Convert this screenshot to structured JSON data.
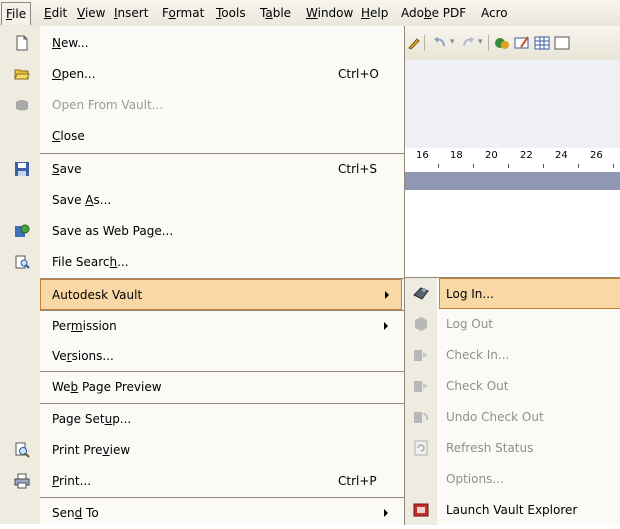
{
  "menubar": {
    "items": [
      {
        "pre": "",
        "u": "F",
        "post": "ile"
      },
      {
        "pre": "",
        "u": "E",
        "post": "dit"
      },
      {
        "pre": "",
        "u": "V",
        "post": "iew"
      },
      {
        "pre": "",
        "u": "I",
        "post": "nsert"
      },
      {
        "pre": "F",
        "u": "o",
        "post": "rmat"
      },
      {
        "pre": "",
        "u": "T",
        "post": "ools"
      },
      {
        "pre": "T",
        "u": "a",
        "post": "ble"
      },
      {
        "pre": "",
        "u": "W",
        "post": "indow"
      },
      {
        "pre": "",
        "u": "H",
        "post": "elp"
      },
      {
        "pre": "Ado",
        "u": "b",
        "post": "e PDF"
      },
      {
        "pre": "Acro",
        "u": "",
        "post": ""
      }
    ]
  },
  "ruler": {
    "numbers": [
      "16",
      "18",
      "20",
      "22",
      "24",
      "26"
    ]
  },
  "file_menu": {
    "items": [
      {
        "pre": "",
        "u": "N",
        "post": "ew...",
        "shortcut": "",
        "icon": "new-document-icon"
      },
      {
        "pre": "",
        "u": "O",
        "post": "pen...",
        "shortcut": "Ctrl+O",
        "icon": "open-folder-icon"
      },
      {
        "pre": "Open From Vault...",
        "u": "",
        "post": "",
        "shortcut": "",
        "icon": "vault-open-icon"
      },
      {
        "pre": "",
        "u": "C",
        "post": "lose",
        "shortcut": "",
        "icon": ""
      },
      {
        "pre": "",
        "u": "S",
        "post": "ave",
        "shortcut": "Ctrl+S",
        "icon": "save-disk-icon"
      },
      {
        "pre": "Save ",
        "u": "A",
        "post": "s...",
        "shortcut": "",
        "icon": ""
      },
      {
        "pre": "Save as Web Pa",
        "u": "g",
        "post": "e...",
        "shortcut": "",
        "icon": "save-web-icon"
      },
      {
        "pre": "File Searc",
        "u": "h",
        "post": "...",
        "shortcut": "",
        "icon": "file-search-icon"
      },
      {
        "pre": "Autodesk Vault",
        "u": "",
        "post": "",
        "shortcut": "",
        "icon": ""
      },
      {
        "pre": "Per",
        "u": "m",
        "post": "ission",
        "shortcut": "",
        "icon": ""
      },
      {
        "pre": "Ve",
        "u": "r",
        "post": "sions...",
        "shortcut": "",
        "icon": ""
      },
      {
        "pre": "We",
        "u": "b",
        "post": " Page Preview",
        "shortcut": "",
        "icon": ""
      },
      {
        "pre": "Page Set",
        "u": "u",
        "post": "p...",
        "shortcut": "",
        "icon": ""
      },
      {
        "pre": "Print Pre",
        "u": "v",
        "post": "iew",
        "shortcut": "",
        "icon": "print-preview-icon"
      },
      {
        "pre": "",
        "u": "P",
        "post": "rint...",
        "shortcut": "Ctrl+P",
        "icon": "printer-icon"
      },
      {
        "pre": "Sen",
        "u": "d",
        "post": " To",
        "shortcut": "",
        "icon": ""
      }
    ]
  },
  "vault_submenu": {
    "items": [
      {
        "label": "Log In...",
        "icon": "vault-login-icon"
      },
      {
        "label": "Log Out",
        "icon": "vault-logout-icon"
      },
      {
        "label": "Check In...",
        "icon": "check-in-icon"
      },
      {
        "label": "Check Out",
        "icon": "check-out-icon"
      },
      {
        "label": "Undo Check Out",
        "icon": "undo-check-out-icon"
      },
      {
        "label": "Refresh Status",
        "icon": "refresh-icon"
      },
      {
        "label": "Options...",
        "icon": ""
      },
      {
        "label": "Launch Vault Explorer",
        "icon": "vault-explorer-icon"
      }
    ]
  },
  "colors": {
    "highlight": "#f9d8a6",
    "highlight_border": "#c67f2f",
    "ruler_band": "#8f97b3"
  }
}
